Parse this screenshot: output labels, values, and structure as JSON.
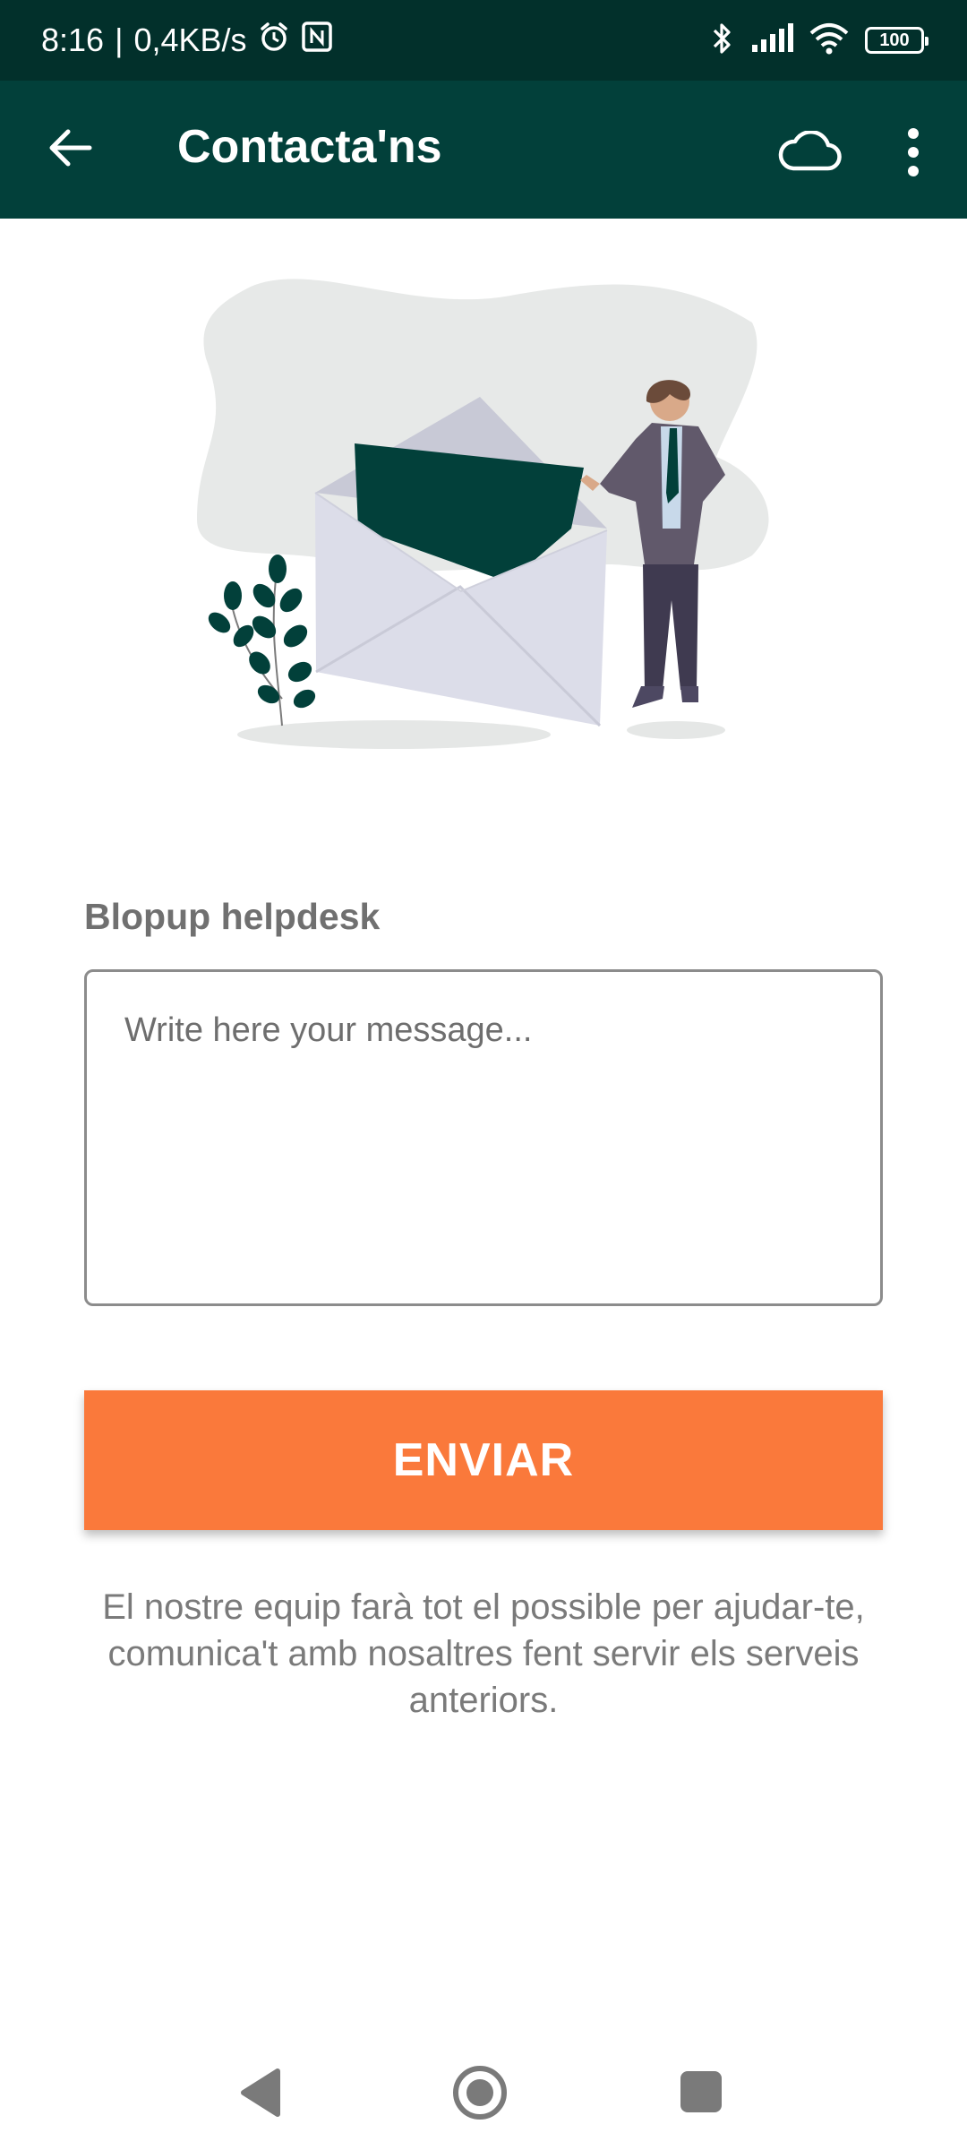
{
  "status_bar": {
    "time": "8:16",
    "separator": "|",
    "speed": "0,4KB/s",
    "battery": "100",
    "icons": [
      "alarm-icon",
      "nfc-icon",
      "bluetooth-icon",
      "signal-icon",
      "wifi-icon",
      "battery-icon"
    ]
  },
  "app_bar": {
    "title": "Contacta'ns",
    "icons": [
      "back-arrow-icon",
      "cloud-icon",
      "more-vert-icon"
    ]
  },
  "form": {
    "label": "Blopup helpdesk",
    "message_placeholder": "Write here your message...",
    "message_value": "",
    "send_label": "ENVIAR"
  },
  "info_text": "El nostre equip farà tot el possible per ajudar-te, comunica't amb nosaltres fent servir els serveis anteriors.",
  "nav_bar": {
    "icons": [
      "nav-back-icon",
      "nav-home-icon",
      "nav-recents-icon"
    ]
  },
  "colors": {
    "status_bar": "#02302b",
    "app_bar": "#02403a",
    "accent": "#fa793b",
    "text_gray": "#707070"
  }
}
